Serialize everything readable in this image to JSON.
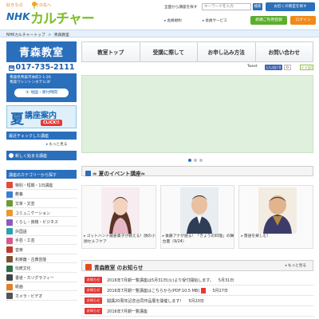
{
  "header": {
    "tagline_1": "好きなの",
    "tagline_2": "その先へ",
    "logo_nhk": "NHK",
    "logo_culture": "カルチャー",
    "search_note": "全国から講座を探す",
    "search_placeholder": "キーワードを入力",
    "search_button": "検索",
    "find_school": "お近くの教室を探す",
    "link_rules": "会員規約",
    "link_service": "会員サービス",
    "register": "新規ご利用登録",
    "login": "ログイン"
  },
  "breadcrumb": {
    "home": "NHKカルチャートップ",
    "sep": ">",
    "current": "青森教室"
  },
  "school": {
    "name": "青森教室",
    "phone": "017-735-2111",
    "address_1": "青森県青森市本町2-1-26",
    "address_2": "青森ワシントンホテル3F",
    "map_button": "地図・受付時間"
  },
  "summer_banner": {
    "ka": "夏",
    "title": "講座案内",
    "click": "CLICK!!"
  },
  "recent": {
    "title": "最近チェックした講座",
    "more": "もっと見る"
  },
  "new_course": "新しく始まる講座",
  "categories": {
    "title": "講座のカテゴリーから探す",
    "items": [
      {
        "label": "特別・短期・1日講座",
        "color": "#e24b3a"
      },
      {
        "label": "教養",
        "color": "#3a7fd0"
      },
      {
        "label": "文章・文芸",
        "color": "#6b9a3a"
      },
      {
        "label": "コミュニケーション",
        "color": "#e89a2a"
      },
      {
        "label": "くらし・資格・ビジネス",
        "color": "#8a5cc0"
      },
      {
        "label": "外国語",
        "color": "#2aa0b0"
      },
      {
        "label": "手芸・工芸",
        "color": "#d85a8a"
      },
      {
        "label": "音楽",
        "color": "#c0392b"
      },
      {
        "label": "和楽器・古典芸能",
        "color": "#7a5230"
      },
      {
        "label": "伝統文化",
        "color": "#2c6e49"
      },
      {
        "label": "書道・カリグラフィー",
        "color": "#444444"
      },
      {
        "label": "絵画",
        "color": "#e67e22"
      },
      {
        "label": "カメラ・ビデオ",
        "color": "#555555"
      }
    ]
  },
  "topnav": [
    "教室トップ",
    "受講に際して",
    "お申し込み方法",
    "お問い合わせ"
  ],
  "social": {
    "tweet": "Tweet",
    "like": "いいね! 0",
    "count": "0",
    "iine": "イイね!"
  },
  "events": {
    "title": "∞ 夏のイベント講座∞",
    "cards": [
      {
        "caption": "ゴットハンド飯倉美子が教える！顔の小顔セルフケア"
      },
      {
        "caption": "後藤アナが語る！「きょうの料理」の舞台裏（9/24）"
      },
      {
        "caption": "落語を楽しむ！"
      }
    ]
  },
  "news": {
    "title": "青森教室 のお知らせ",
    "more": "もっと見る",
    "badge": "お知らせ",
    "items": [
      {
        "text": "2016年7月期一覧講座は5月31日(火)より受付開始します。",
        "date": "5月31日",
        "pdf": false
      },
      {
        "text": "2016年7月期一覧講座はこちらから(PDF:10.5 MB)",
        "date": "5月27日",
        "pdf": true
      },
      {
        "text": "開講20周年記念合同作品展を開催します！",
        "date": "5月20日",
        "pdf": false
      },
      {
        "text": "2016年7月期一覧講座",
        "date": "",
        "pdf": false
      }
    ]
  },
  "colors": {
    "brand_blue": "#2a6fbc",
    "culture_green": "#7bbf2a",
    "orange": "#f08a19",
    "red": "#e53935"
  }
}
